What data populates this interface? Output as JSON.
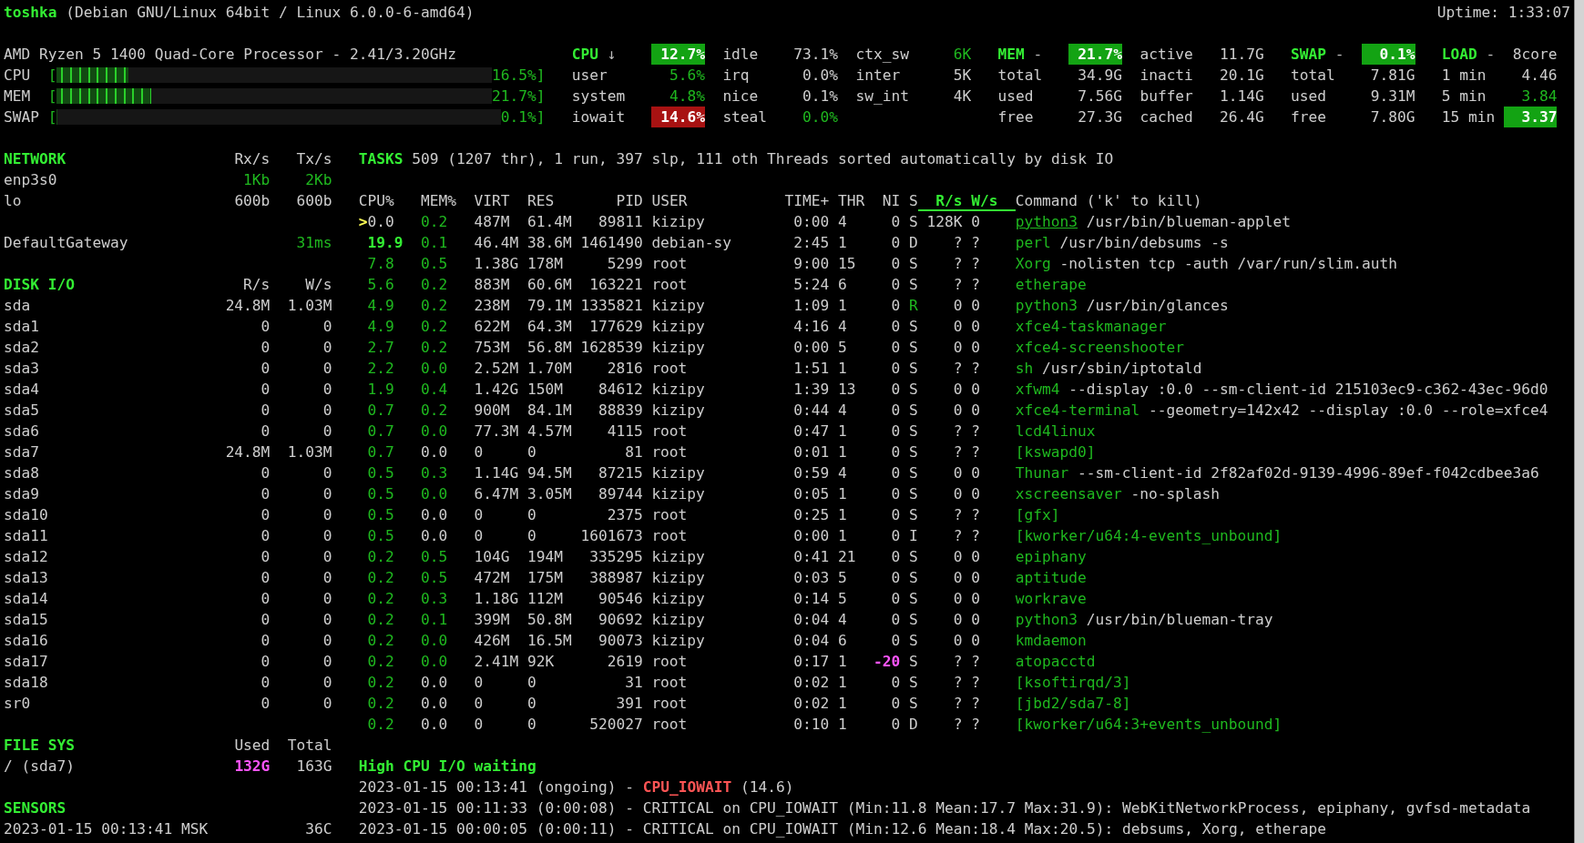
{
  "title": {
    "hostname": "toshka",
    "system": "(Debian GNU/Linux 64bit / Linux 6.0.0-6-amd64)",
    "uptime": "Uptime: 1:33:07"
  },
  "quicklook": {
    "processor": "AMD Ryzen 5 1400 Quad-Core Processor - 2.41/3.20GHz",
    "bars": [
      {
        "label": "CPU",
        "bracket": "[",
        "level": 0.165,
        "reading": "16.5%]"
      },
      {
        "label": "MEM",
        "bracket": "[",
        "level": 0.217,
        "reading": "21.7%]"
      },
      {
        "label": "SWAP",
        "bracket": "[",
        "level": 0.001,
        "reading": "0.1%]"
      }
    ]
  },
  "summary": [
    {
      "title": "CPU",
      "suffix": "↓",
      "value": "12.7%",
      "kind": "ok_box",
      "rows": [
        {
          "name": "user",
          "value": "5.6%",
          "kind": "ok"
        },
        {
          "name": "system",
          "value": "4.8%",
          "kind": "ok"
        },
        {
          "name": "iowait",
          "value": "14.6%",
          "kind": "critical_box"
        }
      ]
    },
    {
      "rows": [
        {
          "name": "idle",
          "value": "73.1%",
          "kind": "plain"
        },
        {
          "name": "irq",
          "value": "0.0%",
          "kind": "plain"
        },
        {
          "name": "nice",
          "value": "0.1%",
          "kind": "plain"
        },
        {
          "name": "steal",
          "value": "0.0%",
          "kind": "ok"
        }
      ]
    },
    {
      "rows": [
        {
          "name": "ctx_sw",
          "value": "6K",
          "kind": "ok"
        },
        {
          "name": "inter",
          "value": "5K",
          "kind": "plain"
        },
        {
          "name": "sw_int",
          "value": "4K",
          "kind": "plain"
        }
      ]
    },
    {
      "title": "MEM",
      "suffix": "-",
      "value": "21.7%",
      "kind": "ok_box",
      "rows": [
        {
          "name": "total",
          "value": "34.9G",
          "kind": "plain"
        },
        {
          "name": "used",
          "value": "7.56G",
          "kind": "plain"
        },
        {
          "name": "free",
          "value": "27.3G",
          "kind": "plain"
        }
      ]
    },
    {
      "rows": [
        {
          "name": "active",
          "value": "11.7G",
          "kind": "plain"
        },
        {
          "name": "inacti",
          "value": "20.1G",
          "kind": "plain"
        },
        {
          "name": "buffer",
          "value": "1.14G",
          "kind": "plain"
        },
        {
          "name": "cached",
          "value": "26.4G",
          "kind": "plain"
        }
      ]
    },
    {
      "title": "SWAP",
      "suffix": "-",
      "value": "0.1%",
      "kind": "ok_box",
      "rows": [
        {
          "name": "total",
          "value": "7.81G",
          "kind": "plain"
        },
        {
          "name": "used",
          "value": "9.31M",
          "kind": "plain"
        },
        {
          "name": "free",
          "value": "7.80G",
          "kind": "plain"
        }
      ]
    },
    {
      "title": "LOAD",
      "suffix": "-",
      "value": "8core",
      "kind": "plain",
      "rows": [
        {
          "name": "1 min",
          "value": "4.46",
          "kind": "plain"
        },
        {
          "name": "5 min",
          "value": "3.84",
          "kind": "ok"
        },
        {
          "name": "15 min",
          "value": "3.37",
          "kind": "ok_box"
        }
      ]
    }
  ],
  "sidebar": [
    {
      "title": "NETWORK",
      "columns": [
        "Rx/s",
        "Tx/s"
      ],
      "rows": [
        {
          "name": "enp3s0",
          "values": [
            {
              "text": "1Kb",
              "kind": "ok"
            },
            {
              "text": "2Kb",
              "kind": "ok"
            }
          ]
        },
        {
          "name": "lo",
          "values": [
            "600b",
            "600b"
          ]
        }
      ]
    },
    {
      "rows": [
        {
          "name": "DefaultGateway",
          "values": [
            {
              "text": "31ms",
              "kind": "ok"
            }
          ]
        }
      ]
    },
    {
      "title": "DISK I/O",
      "columns": [
        "R/s",
        "W/s"
      ],
      "rows": [
        {
          "name": "sda",
          "values": [
            "24.8M",
            "1.03M"
          ]
        },
        {
          "name": "sda1",
          "values": [
            "0",
            "0"
          ]
        },
        {
          "name": "sda2",
          "values": [
            "0",
            "0"
          ]
        },
        {
          "name": "sda3",
          "values": [
            "0",
            "0"
          ]
        },
        {
          "name": "sda4",
          "values": [
            "0",
            "0"
          ]
        },
        {
          "name": "sda5",
          "values": [
            "0",
            "0"
          ]
        },
        {
          "name": "sda6",
          "values": [
            "0",
            "0"
          ]
        },
        {
          "name": "sda7",
          "values": [
            "24.8M",
            "1.03M"
          ]
        },
        {
          "name": "sda8",
          "values": [
            "0",
            "0"
          ]
        },
        {
          "name": "sda9",
          "values": [
            "0",
            "0"
          ]
        },
        {
          "name": "sda10",
          "values": [
            "0",
            "0"
          ]
        },
        {
          "name": "sda11",
          "values": [
            "0",
            "0"
          ]
        },
        {
          "name": "sda12",
          "values": [
            "0",
            "0"
          ]
        },
        {
          "name": "sda13",
          "values": [
            "0",
            "0"
          ]
        },
        {
          "name": "sda14",
          "values": [
            "0",
            "0"
          ]
        },
        {
          "name": "sda15",
          "values": [
            "0",
            "0"
          ]
        },
        {
          "name": "sda16",
          "values": [
            "0",
            "0"
          ]
        },
        {
          "name": "sda17",
          "values": [
            "0",
            "0"
          ]
        },
        {
          "name": "sda18",
          "values": [
            "0",
            "0"
          ]
        },
        {
          "name": "sr0",
          "values": [
            "0",
            "0"
          ]
        }
      ]
    },
    {
      "title": "FILE SYS",
      "columns": [
        "Used",
        "Total"
      ],
      "rows": [
        {
          "name": "/ (sda7)",
          "values": [
            {
              "text": "132G",
              "kind": "warning_bold"
            },
            {
              "text": "163G",
              "kind": "plain"
            }
          ]
        }
      ]
    },
    {
      "title": "SENSORS",
      "rows": [
        {
          "name": "2023-01-15 00:13:41 MSK",
          "values": [
            "36C"
          ]
        }
      ]
    }
  ],
  "tasks": {
    "title": "TASKS",
    "summary": "509 (1207 thr), 1 run, 397 slp, 111 oth Threads sorted automatically by disk IO"
  },
  "processes": {
    "cursor": ">",
    "columns": [
      {
        "label": "CPU%",
        "highlighted": false
      },
      {
        "label": "MEM%",
        "highlighted": false
      },
      {
        "label": "VIRT",
        "highlighted": false
      },
      {
        "label": "RES",
        "highlighted": false
      },
      {
        "label": "PID",
        "highlighted": false
      },
      {
        "label": "USER",
        "highlighted": false
      },
      {
        "label": "TIME+",
        "highlighted": false
      },
      {
        "label": "THR",
        "highlighted": false
      },
      {
        "label": "NI",
        "highlighted": false
      },
      {
        "label": "S",
        "highlighted": false
      },
      {
        "label": "R/s",
        "highlighted": true
      },
      {
        "label": "W/s",
        "highlighted": true
      },
      {
        "label": "Command ('k' to kill)",
        "highlighted": false
      }
    ],
    "rows": [
      {
        "selected": true,
        "cpu": {
          "text": "0.0",
          "kind": "plain"
        },
        "mem": {
          "text": "0.2",
          "kind": "ok"
        },
        "virt": "487M",
        "res": "61.4M",
        "pid": "89811",
        "user": "kizipy",
        "time": "0:00",
        "thr": "4",
        "ni": "0",
        "s": "S",
        "r_s": "128K",
        "w_s": "0",
        "command": "python3",
        "args": "/usr/bin/blueman-applet"
      },
      {
        "selected": false,
        "cpu": {
          "text": "19.9",
          "kind": "ok_bold"
        },
        "mem": {
          "text": "0.1",
          "kind": "ok"
        },
        "virt": "46.4M",
        "res": "38.6M",
        "pid": "1461490",
        "user": "debian-sy",
        "time": "2:45",
        "thr": "1",
        "ni": "0",
        "s": "D",
        "r_s": "?",
        "w_s": "?",
        "command": "perl",
        "args": "/usr/bin/debsums -s"
      },
      {
        "selected": false,
        "cpu": {
          "text": "7.8",
          "kind": "ok"
        },
        "mem": {
          "text": "0.5",
          "kind": "ok"
        },
        "virt": "1.38G",
        "res": "178M",
        "pid": "5299",
        "user": "root",
        "time": "9:00",
        "thr": "15",
        "ni": "0",
        "s": "S",
        "r_s": "?",
        "w_s": "?",
        "command": "Xorg",
        "args": "-nolisten tcp -auth /var/run/slim.auth"
      },
      {
        "selected": false,
        "cpu": {
          "text": "5.6",
          "kind": "ok"
        },
        "mem": {
          "text": "0.2",
          "kind": "ok"
        },
        "virt": "883M",
        "res": "60.6M",
        "pid": "163221",
        "user": "root",
        "time": "5:24",
        "thr": "6",
        "ni": "0",
        "s": "S",
        "r_s": "?",
        "w_s": "?",
        "command": "etherape"
      },
      {
        "selected": false,
        "cpu": {
          "text": "4.9",
          "kind": "ok"
        },
        "mem": {
          "text": "0.2",
          "kind": "ok"
        },
        "virt": "238M",
        "res": "79.1M",
        "pid": "1335821",
        "user": "kizipy",
        "time": "1:09",
        "thr": "1",
        "ni": "0",
        "s": {
          "text": "R",
          "kind": "ok"
        },
        "r_s": "0",
        "w_s": "0",
        "command": "python3",
        "args": "/usr/bin/glances"
      },
      {
        "selected": false,
        "cpu": {
          "text": "4.9",
          "kind": "ok"
        },
        "mem": {
          "text": "0.2",
          "kind": "ok"
        },
        "virt": "622M",
        "res": "64.3M",
        "pid": "177629",
        "user": "kizipy",
        "time": "4:16",
        "thr": "4",
        "ni": "0",
        "s": "S",
        "r_s": "0",
        "w_s": "0",
        "command": "xfce4-taskmanager"
      },
      {
        "selected": false,
        "cpu": {
          "text": "2.7",
          "kind": "ok"
        },
        "mem": {
          "text": "0.2",
          "kind": "ok"
        },
        "virt": "753M",
        "res": "56.8M",
        "pid": "1628539",
        "user": "kizipy",
        "time": "0:00",
        "thr": "5",
        "ni": "0",
        "s": "S",
        "r_s": "0",
        "w_s": "0",
        "command": "xfce4-screenshooter"
      },
      {
        "selected": false,
        "cpu": {
          "text": "2.2",
          "kind": "ok"
        },
        "mem": {
          "text": "0.0",
          "kind": "ok"
        },
        "virt": "2.52M",
        "res": "1.70M",
        "pid": "2816",
        "user": "root",
        "time": "1:51",
        "thr": "1",
        "ni": "0",
        "s": "S",
        "r_s": "?",
        "w_s": "?",
        "command": "sh",
        "args": "/usr/sbin/iptotald"
      },
      {
        "selected": false,
        "cpu": {
          "text": "1.9",
          "kind": "ok"
        },
        "mem": {
          "text": "0.4",
          "kind": "ok"
        },
        "virt": "1.42G",
        "res": "150M",
        "pid": "84612",
        "user": "kizipy",
        "time": "1:39",
        "thr": "13",
        "ni": "0",
        "s": "S",
        "r_s": "0",
        "w_s": "0",
        "command": "xfwm4",
        "args": "--display :0.0 --sm-client-id 215103ec9-c362-43ec-96d0"
      },
      {
        "selected": false,
        "cpu": {
          "text": "0.7",
          "kind": "ok"
        },
        "mem": {
          "text": "0.2",
          "kind": "ok"
        },
        "virt": "900M",
        "res": "84.1M",
        "pid": "88839",
        "user": "kizipy",
        "time": "0:44",
        "thr": "4",
        "ni": "0",
        "s": "S",
        "r_s": "0",
        "w_s": "0",
        "command": "xfce4-terminal",
        "args": "--geometry=142x42 --display :0.0 --role=xfce4"
      },
      {
        "selected": false,
        "cpu": {
          "text": "0.7",
          "kind": "ok"
        },
        "mem": {
          "text": "0.0",
          "kind": "ok"
        },
        "virt": "77.3M",
        "res": "4.57M",
        "pid": "4115",
        "user": "root",
        "time": "0:47",
        "thr": "1",
        "ni": "0",
        "s": "S",
        "r_s": "?",
        "w_s": "?",
        "command": "lcd4linux"
      },
      {
        "selected": false,
        "cpu": {
          "text": "0.7",
          "kind": "ok"
        },
        "mem": {
          "text": "0.0",
          "kind": "plain"
        },
        "virt": "0",
        "res": "0",
        "pid": "81",
        "user": "root",
        "time": "0:01",
        "thr": "1",
        "ni": "0",
        "s": "S",
        "r_s": "?",
        "w_s": "?",
        "command": "[kswapd0]"
      },
      {
        "selected": false,
        "cpu": {
          "text": "0.5",
          "kind": "ok"
        },
        "mem": {
          "text": "0.3",
          "kind": "ok"
        },
        "virt": "1.14G",
        "res": "94.5M",
        "pid": "87215",
        "user": "kizipy",
        "time": "0:59",
        "thr": "4",
        "ni": "0",
        "s": "S",
        "r_s": "0",
        "w_s": "0",
        "command": "Thunar",
        "args": "--sm-client-id 2f82af02d-9139-4996-89ef-f042cdbee3a6"
      },
      {
        "selected": false,
        "cpu": {
          "text": "0.5",
          "kind": "ok"
        },
        "mem": {
          "text": "0.0",
          "kind": "ok"
        },
        "virt": "6.47M",
        "res": "3.05M",
        "pid": "89744",
        "user": "kizipy",
        "time": "0:05",
        "thr": "1",
        "ni": "0",
        "s": "S",
        "r_s": "0",
        "w_s": "0",
        "command": "xscreensaver",
        "args": "-no-splash"
      },
      {
        "selected": false,
        "cpu": {
          "text": "0.5",
          "kind": "ok"
        },
        "mem": {
          "text": "0.0",
          "kind": "plain"
        },
        "virt": "0",
        "res": "0",
        "pid": "2375",
        "user": "root",
        "time": "0:25",
        "thr": "1",
        "ni": "0",
        "s": "S",
        "r_s": "?",
        "w_s": "?",
        "command": "[gfx]"
      },
      {
        "selected": false,
        "cpu": {
          "text": "0.5",
          "kind": "ok"
        },
        "mem": {
          "text": "0.0",
          "kind": "plain"
        },
        "virt": "0",
        "res": "0",
        "pid": "1601673",
        "user": "root",
        "time": "0:00",
        "thr": "1",
        "ni": "0",
        "s": "I",
        "r_s": "?",
        "w_s": "?",
        "command": "[kworker/u64:4-events_unbound]"
      },
      {
        "selected": false,
        "cpu": {
          "text": "0.2",
          "kind": "ok"
        },
        "mem": {
          "text": "0.5",
          "kind": "ok"
        },
        "virt": "104G",
        "res": "194M",
        "pid": "335295",
        "user": "kizipy",
        "time": "0:41",
        "thr": "21",
        "ni": "0",
        "s": "S",
        "r_s": "0",
        "w_s": "0",
        "command": "epiphany"
      },
      {
        "selected": false,
        "cpu": {
          "text": "0.2",
          "kind": "ok"
        },
        "mem": {
          "text": "0.5",
          "kind": "ok"
        },
        "virt": "472M",
        "res": "175M",
        "pid": "388987",
        "user": "kizipy",
        "time": "0:03",
        "thr": "5",
        "ni": "0",
        "s": "S",
        "r_s": "0",
        "w_s": "0",
        "command": "aptitude"
      },
      {
        "selected": false,
        "cpu": {
          "text": "0.2",
          "kind": "ok"
        },
        "mem": {
          "text": "0.3",
          "kind": "ok"
        },
        "virt": "1.18G",
        "res": "112M",
        "pid": "90546",
        "user": "kizipy",
        "time": "0:14",
        "thr": "5",
        "ni": "0",
        "s": "S",
        "r_s": "0",
        "w_s": "0",
        "command": "workrave"
      },
      {
        "selected": false,
        "cpu": {
          "text": "0.2",
          "kind": "ok"
        },
        "mem": {
          "text": "0.1",
          "kind": "ok"
        },
        "virt": "399M",
        "res": "50.8M",
        "pid": "90692",
        "user": "kizipy",
        "time": "0:04",
        "thr": "4",
        "ni": "0",
        "s": "S",
        "r_s": "0",
        "w_s": "0",
        "command": "python3",
        "args": "/usr/bin/blueman-tray"
      },
      {
        "selected": false,
        "cpu": {
          "text": "0.2",
          "kind": "ok"
        },
        "mem": {
          "text": "0.0",
          "kind": "ok"
        },
        "virt": "426M",
        "res": "16.5M",
        "pid": "90073",
        "user": "kizipy",
        "time": "0:04",
        "thr": "6",
        "ni": "0",
        "s": "S",
        "r_s": "0",
        "w_s": "0",
        "command": "kmdaemon"
      },
      {
        "selected": false,
        "cpu": {
          "text": "0.2",
          "kind": "ok"
        },
        "mem": {
          "text": "0.0",
          "kind": "ok"
        },
        "virt": "2.41M",
        "res": "92K",
        "pid": "2619",
        "user": "root",
        "time": "0:17",
        "thr": "1",
        "ni": {
          "text": "-20",
          "kind": "warning_bold"
        },
        "s": "S",
        "r_s": "?",
        "w_s": "?",
        "command": "atopacctd"
      },
      {
        "selected": false,
        "cpu": {
          "text": "0.2",
          "kind": "ok"
        },
        "mem": {
          "text": "0.0",
          "kind": "plain"
        },
        "virt": "0",
        "res": "0",
        "pid": "31",
        "user": "root",
        "time": "0:02",
        "thr": "1",
        "ni": "0",
        "s": "S",
        "r_s": "?",
        "w_s": "?",
        "command": "[ksoftirqd/3]"
      },
      {
        "selected": false,
        "cpu": {
          "text": "0.2",
          "kind": "ok"
        },
        "mem": {
          "text": "0.0",
          "kind": "plain"
        },
        "virt": "0",
        "res": "0",
        "pid": "391",
        "user": "root",
        "time": "0:02",
        "thr": "1",
        "ni": "0",
        "s": "S",
        "r_s": "?",
        "w_s": "?",
        "command": "[jbd2/sda7-8]"
      },
      {
        "selected": false,
        "cpu": {
          "text": "0.2",
          "kind": "ok"
        },
        "mem": {
          "text": "0.0",
          "kind": "plain"
        },
        "virt": "0",
        "res": "0",
        "pid": "520027",
        "user": "root",
        "time": "0:10",
        "thr": "1",
        "ni": "0",
        "s": "D",
        "r_s": "?",
        "w_s": "?",
        "command": "[kworker/u64:3+events_unbound]"
      }
    ]
  },
  "alerts": {
    "title": "High CPU I/O waiting",
    "events": [
      {
        "prefix": "2023-01-15 00:13:41 (ongoing) -",
        "alert": "CPU_IOWAIT",
        "suffix": "(14.6)",
        "ongoing": true
      },
      {
        "prefix": "2023-01-15 00:11:33 (0:00:08) - CRITICAL on",
        "alert": "CPU_IOWAIT",
        "suffix": "(Min:11.8 Mean:17.7 Max:31.9): WebKitNetworkProcess, epiphany, gvfsd-metadata",
        "ongoing": false
      },
      {
        "prefix": "2023-01-15 00:00:05 (0:00:11) - CRITICAL on",
        "alert": "CPU_IOWAIT",
        "suffix": "(Min:12.6 Mean:18.4 Max:20.5): debsums, Xorg, etherape",
        "ongoing": false
      }
    ]
  }
}
